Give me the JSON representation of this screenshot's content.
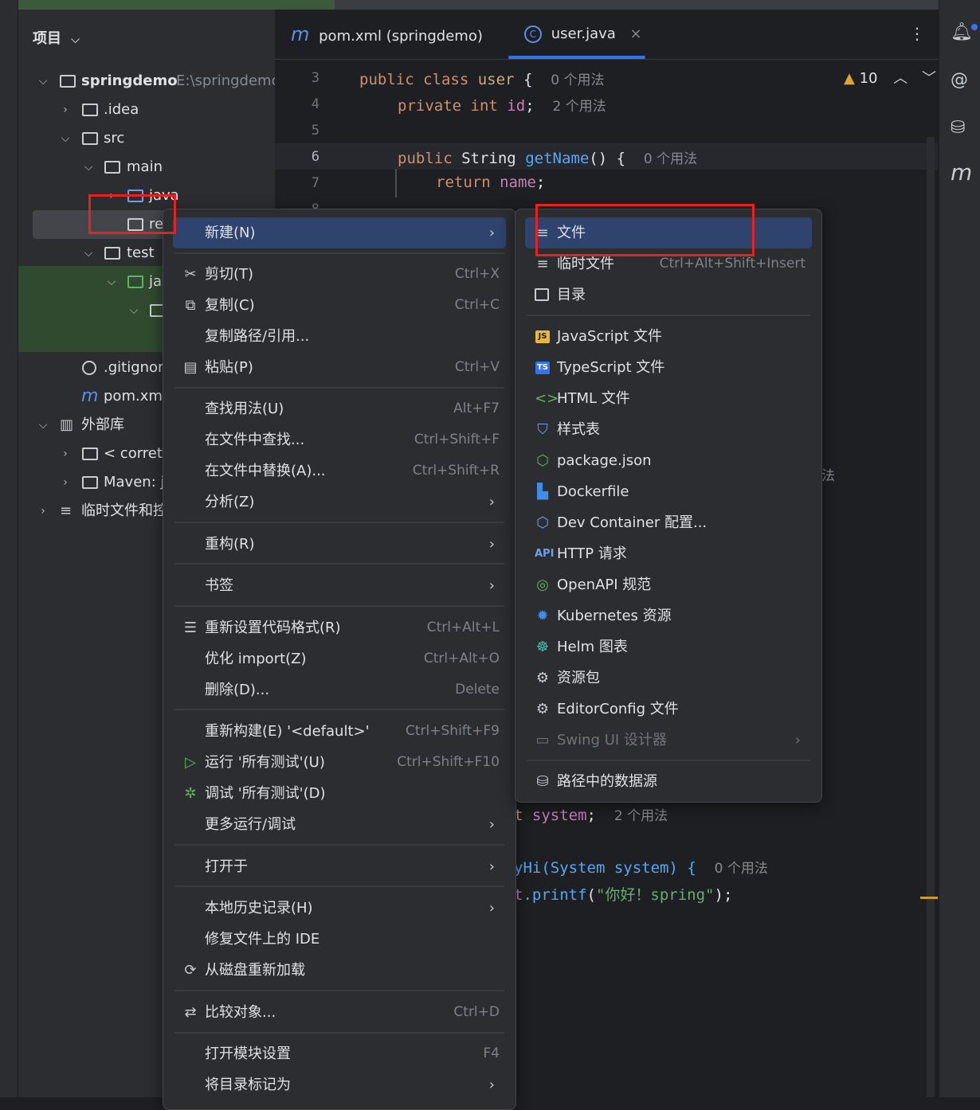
{
  "project": {
    "header": "项目",
    "tree": [
      {
        "label": "springdemo",
        "path": "E:\\springdemo"
      },
      {
        "label": ".idea"
      },
      {
        "label": "src"
      },
      {
        "label": "main"
      },
      {
        "label": "java"
      },
      {
        "label": "re"
      },
      {
        "label": "test"
      },
      {
        "label": "ja"
      },
      {
        "label": ".gitignor"
      },
      {
        "label": "pom.xml"
      },
      {
        "label": "外部库"
      },
      {
        "label": "< corrett"
      },
      {
        "label": "Maven: j"
      },
      {
        "label": "临时文件和控"
      }
    ]
  },
  "editor": {
    "tabs": [
      {
        "icon": "m",
        "label": "pom.xml (springdemo)"
      },
      {
        "icon": "C",
        "label": "user.java"
      }
    ],
    "tab_close": "×",
    "warnings": "10",
    "lines": [
      {
        "no": "3"
      },
      {
        "no": "4"
      },
      {
        "no": "5"
      },
      {
        "no": "6"
      },
      {
        "no": "7"
      },
      {
        "no": "8"
      }
    ],
    "code": {
      "l3_kw": "public class",
      "l3_name": "user",
      "l3_brace": " {",
      "l3_hint": "0 个用法",
      "l4_kw": "private int",
      "l4_name": "id",
      "l4_semi": ";",
      "l4_hint": "2 个用法",
      "l6_kw": "public",
      "l6_type": "String",
      "l6_fn": "getName",
      "l6_rest": "() {",
      "l6_hint": "0 个用法",
      "l7_kw": "return",
      "l7_name": "name",
      "l7_semi": ";",
      "b1_pre": "t",
      "b1_name": "system",
      "b1_semi": ";",
      "b1_hint": "2 个用法",
      "b2_pre": "yHi(System system) {",
      "b2_hint": "0 个用法",
      "b3_pre": "t",
      "b3_fn": ".printf",
      "b3_open": "(",
      "b3_str": "\"你好！spring\"",
      "b3_close": ");",
      "stray": "法"
    }
  },
  "context_menu": {
    "items": [
      {
        "label": "新建(N)",
        "submenu": true
      },
      {
        "label": "剪切(T)",
        "shortcut": "Ctrl+X",
        "icon": "scissors-icon"
      },
      {
        "label": "复制(C)",
        "shortcut": "Ctrl+C",
        "icon": "copy-icon"
      },
      {
        "label": "复制路径/引用..."
      },
      {
        "label": "粘贴(P)",
        "shortcut": "Ctrl+V",
        "icon": "paste-icon"
      },
      {
        "label": "查找用法(U)",
        "shortcut": "Alt+F7"
      },
      {
        "label": "在文件中查找...",
        "shortcut": "Ctrl+Shift+F"
      },
      {
        "label": "在文件中替换(A)...",
        "shortcut": "Ctrl+Shift+R"
      },
      {
        "label": "分析(Z)",
        "submenu": true
      },
      {
        "label": "重构(R)",
        "submenu": true
      },
      {
        "label": "书签",
        "submenu": true
      },
      {
        "label": "重新设置代码格式(R)",
        "shortcut": "Ctrl+Alt+L",
        "icon": "format-icon"
      },
      {
        "label": "优化 import(Z)",
        "shortcut": "Ctrl+Alt+O"
      },
      {
        "label": "删除(D)...",
        "shortcut": "Delete"
      },
      {
        "label": "重新构建(E) '<default>'",
        "shortcut": "Ctrl+Shift+F9"
      },
      {
        "label": "运行 '所有测试'(U)",
        "shortcut": "Ctrl+Shift+F10",
        "icon": "run-icon"
      },
      {
        "label": "调试 '所有测试'(D)",
        "icon": "debug-icon"
      },
      {
        "label": "更多运行/调试",
        "submenu": true
      },
      {
        "label": "打开于",
        "submenu": true
      },
      {
        "label": "本地历史记录(H)",
        "submenu": true
      },
      {
        "label": "修复文件上的 IDE"
      },
      {
        "label": "从磁盘重新加载",
        "icon": "reload-icon"
      },
      {
        "label": "比较对象...",
        "shortcut": "Ctrl+D",
        "icon": "compare-icon"
      },
      {
        "label": "打开模块设置",
        "shortcut": "F4"
      },
      {
        "label": "将目录标记为",
        "submenu": true
      }
    ]
  },
  "new_submenu": {
    "items": [
      {
        "label": "文件",
        "icon": "file-icon"
      },
      {
        "label": "临时文件",
        "shortcut": "Ctrl+Alt+Shift+Insert",
        "icon": "scratch-file-icon"
      },
      {
        "label": "目录",
        "icon": "folder-icon"
      },
      {
        "label": "JavaScript 文件",
        "icon": "javascript-icon",
        "badge": "JS"
      },
      {
        "label": "TypeScript 文件",
        "icon": "typescript-icon",
        "badge": "TS"
      },
      {
        "label": "HTML 文件",
        "icon": "html-icon"
      },
      {
        "label": "样式表",
        "icon": "css-icon"
      },
      {
        "label": "package.json",
        "icon": "nodejs-icon"
      },
      {
        "label": "Dockerfile",
        "icon": "docker-icon"
      },
      {
        "label": "Dev Container 配置...",
        "icon": "cube-icon"
      },
      {
        "label": "HTTP 请求",
        "icon": "api-icon",
        "badge": "API"
      },
      {
        "label": "OpenAPI 规范",
        "icon": "openapi-icon"
      },
      {
        "label": "Kubernetes 资源",
        "icon": "kubernetes-icon"
      },
      {
        "label": "Helm 图表",
        "icon": "helm-icon"
      },
      {
        "label": "资源包",
        "icon": "gear-icon"
      },
      {
        "label": "EditorConfig 文件",
        "icon": "gear-icon"
      },
      {
        "label": "Swing UI 设计器",
        "icon": "window-icon",
        "disabled": true,
        "submenu": true
      },
      {
        "label": "路径中的数据源",
        "icon": "database-icon"
      }
    ]
  },
  "colors": {
    "selection": "#2e436e",
    "highlight_box": "#e8211e",
    "accent": "#3574f0"
  }
}
